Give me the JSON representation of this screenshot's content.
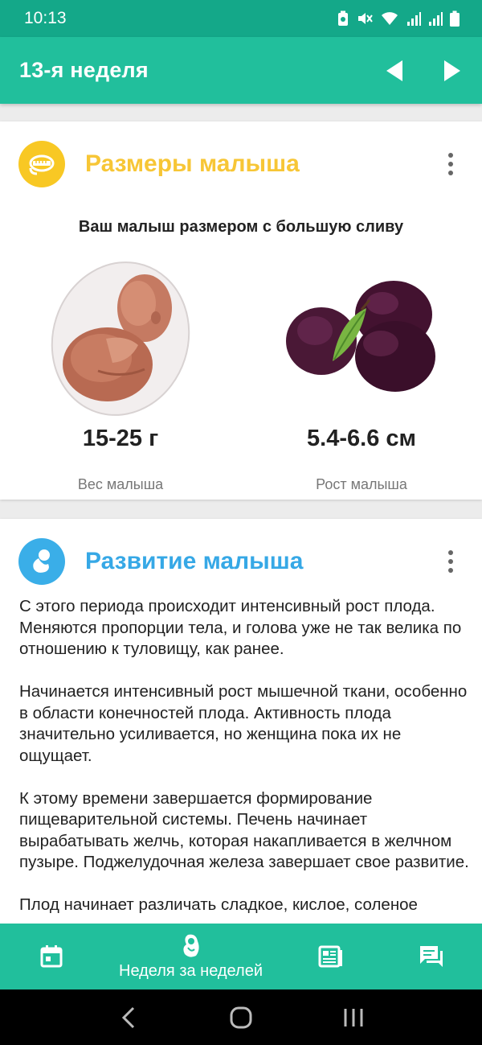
{
  "status_bar": {
    "time": "10:13",
    "icons": [
      "battery-saver-icon",
      "mute-icon",
      "wifi-icon",
      "signal-icon",
      "signal-icon",
      "battery-icon"
    ]
  },
  "header": {
    "title": "13-я неделя",
    "prev_icon": "triangle-left-icon",
    "next_icon": "triangle-right-icon",
    "background": "#21bf9c"
  },
  "size_card": {
    "icon": "tape-measure-icon",
    "icon_color": "#f8c824",
    "title": "Размеры малыша",
    "title_color": "#f7c636",
    "subtitle": "Ваш малыш размером с большую сливу",
    "weight": {
      "value": "15-25 г",
      "label": "Вес малыша"
    },
    "length": {
      "value": "5.4-6.6 см",
      "label": "Рост малыша"
    },
    "images": [
      "fetus-illustration",
      "plums-illustration"
    ]
  },
  "development_card": {
    "icon": "fetus-icon",
    "icon_color": "#3aaee8",
    "title": "Развитие малыша",
    "title_color": "#36a8e6",
    "paragraphs": [
      "С этого периода происходит интенсивный рост плода. Меняются пропорции тела, и голова уже не так велика по отношению к туловищу, как ранее.",
      "Начинается интенсивный рост мышечной ткани, особенно в области конечностей плода. Активность плода значительно усиливается, но женщина пока их не ощущает.",
      "К этому времени завершается формирование пищеварительной системы. Печень начинает вырабатывать желчь, которая накапливается в желчном пузыре. Поджелудочная железа завершает свое развитие.",
      "Плод начинает различать сладкое, кислое, соленое"
    ]
  },
  "bottom_nav": {
    "items": [
      {
        "icon": "calendar-icon",
        "label": ""
      },
      {
        "icon": "fetus-nav-icon",
        "label": "Неделя за неделей"
      },
      {
        "icon": "article-icon",
        "label": ""
      },
      {
        "icon": "chat-icon",
        "label": ""
      }
    ],
    "active_index": 1
  },
  "system_nav": {
    "icons": [
      "back-icon",
      "home-icon",
      "recents-icon"
    ]
  }
}
